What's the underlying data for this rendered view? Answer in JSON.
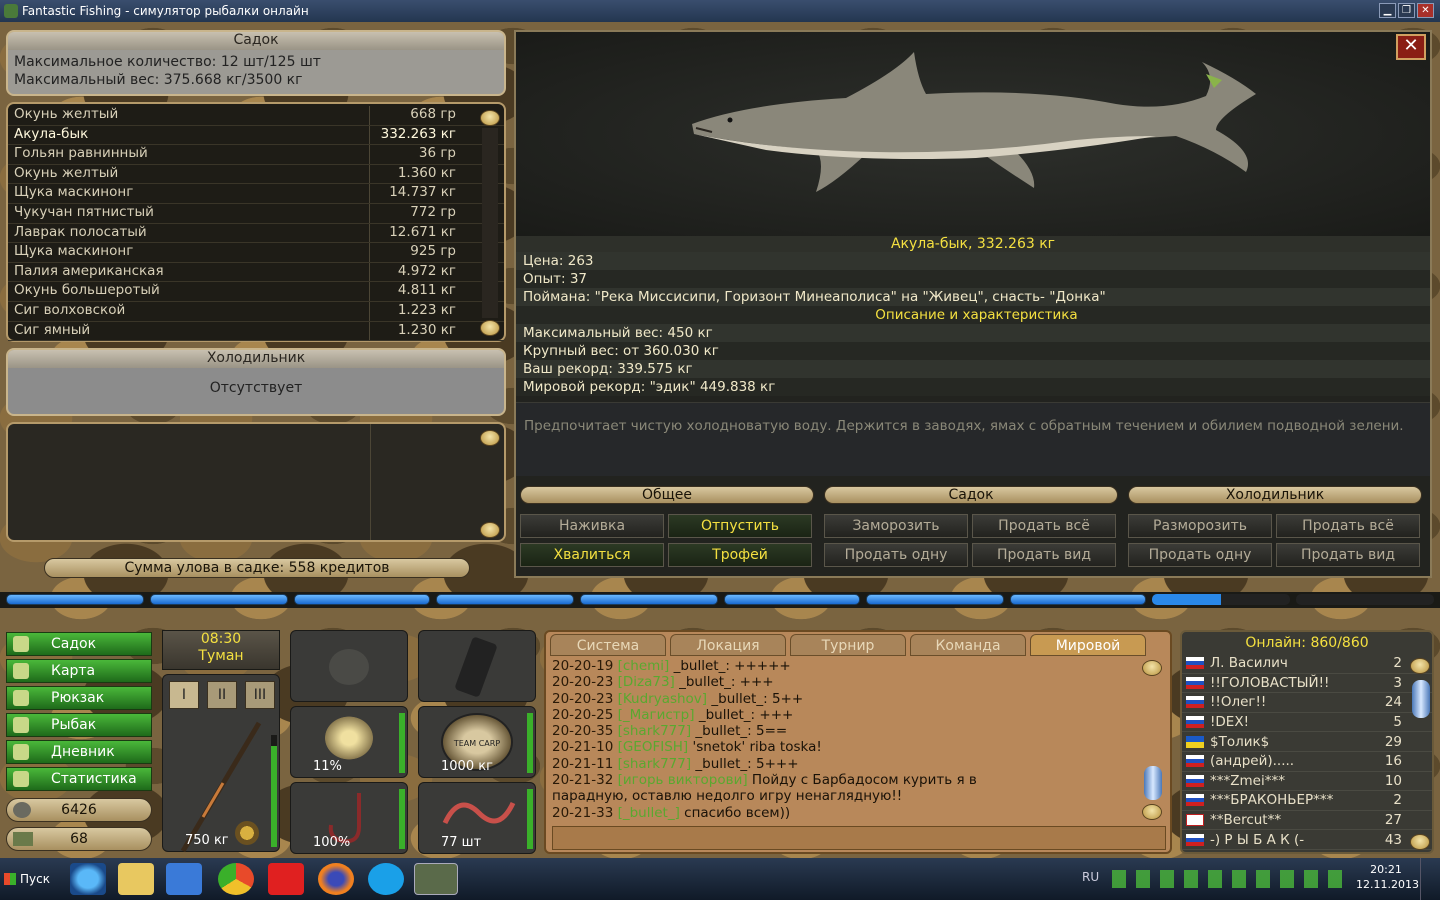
{
  "window": {
    "title": "Fantastic Fishing - симулятор рыбалки онлайн",
    "min": "▁",
    "max": "❐",
    "close": "✕"
  },
  "sadok": {
    "title": "Садок",
    "max_count": "Максимальное количество: 12 шт/125 шт",
    "max_weight": "Максимальный вес: 375.668 кг/3500 кг"
  },
  "fish_list": [
    {
      "name": "Окунь желтый",
      "weight": "668 гр"
    },
    {
      "name": "Акула-бык",
      "weight": "332.263 кг"
    },
    {
      "name": "Гольян равнинный",
      "weight": "36 гр"
    },
    {
      "name": "Окунь желтый",
      "weight": "1.360 кг"
    },
    {
      "name": "Щука маскинонг",
      "weight": "14.737 кг"
    },
    {
      "name": "Чукучан пятнистый",
      "weight": "772 гр"
    },
    {
      "name": "Лаврак полосатый",
      "weight": "12.671 кг"
    },
    {
      "name": "Щука маскинонг",
      "weight": "925 гр"
    },
    {
      "name": "Палия американская",
      "weight": "4.972 кг"
    },
    {
      "name": "Окунь большеротый",
      "weight": "4.811 кг"
    },
    {
      "name": "Сиг волховской",
      "weight": "1.223 кг"
    },
    {
      "name": "Сиг ямный",
      "weight": "1.230 кг"
    }
  ],
  "fridge": {
    "title": "Холодильник",
    "status": "Отсутствует"
  },
  "catch_sum": "Сумма улова в садке: 558 кредитов",
  "fish_info": {
    "title": "Акула-бык, 332.263 кг",
    "price": "Цена: 263",
    "exp": "Опыт: 37",
    "caught": "Поймана: \"Река Миссисипи, Горизонт Минеаполиса\" на \"Живец\", снасть- \"Донка\"",
    "desc_header": "Описание и характеристика",
    "max_weight": "Максимальный вес: 450 кг",
    "big_weight": "Крупный вес: от 360.030 кг",
    "your_record": "Ваш рекорд: 339.575 кг",
    "world_record": "Мировой рекорд: \"эдик\" 449.838 кг",
    "description": "Предпочитает чистую холодноватую воду. Держится в заводях, ямах с обратным течением и обилием подводной зелени."
  },
  "tabs": {
    "general": "Общее",
    "sadok": "Садок",
    "fridge": "Холодильник"
  },
  "actions": {
    "bait": "Наживка",
    "release": "Отпустить",
    "freeze": "Заморозить",
    "sell_all": "Продать всё",
    "defrost": "Разморозить",
    "sell_all2": "Продать всё",
    "brag": "Хвалиться",
    "trophy": "Трофей",
    "sell_one": "Продать одну",
    "sell_kind": "Продать вид",
    "sell_one2": "Продать одну",
    "sell_kind2": "Продать вид"
  },
  "nav": [
    "Садок",
    "Карта",
    "Рюкзак",
    "Рыбак",
    "Дневник",
    "Статистика"
  ],
  "money": {
    "credits": "6426",
    "gold": "68"
  },
  "weather": {
    "time": "08:30",
    "cond": "Туман"
  },
  "gear": {
    "rod": "750 кг",
    "roman": [
      "I",
      "II",
      "III"
    ],
    "reel": "11%",
    "line": "1000 кг",
    "hook": "100%",
    "bait": "77 шт",
    "line_brand": "TEAM CARP"
  },
  "chat": {
    "tabs": [
      "Система",
      "Локация",
      "Турнир",
      "Команда",
      "Мировой"
    ],
    "lines": [
      {
        "t": "20-20-19",
        "u": "[chemi]",
        "m": "_bullet_: +++++"
      },
      {
        "t": "20-20-23",
        "u": "[Diza73]",
        "m": "_bullet_: +++"
      },
      {
        "t": "20-20-23",
        "u": "[Kudryashov]",
        "m": "_bullet_: 5++"
      },
      {
        "t": "20-20-25",
        "u": "[_Магистр]",
        "m": "_bullet_: +++"
      },
      {
        "t": "20-20-35",
        "u": "[shark777]",
        "m": "_bullet_: 5=="
      },
      {
        "t": "20-21-10",
        "u": "[GEOFISH]",
        "m": "'snetok' riba toska!"
      },
      {
        "t": "20-21-11",
        "u": "[shark777]",
        "m": "_bullet_: 5+++"
      },
      {
        "t": "20-21-32",
        "u": "[игорь викторови]",
        "m": "Пойду с Барбадосом курить я в"
      },
      {
        "t": "",
        "u": "",
        "m": "парадную, оставлю недолго игру ненаглядную!!"
      },
      {
        "t": "20-21-33",
        "u": "[_bullet_]",
        "m": "спасибо всем))"
      }
    ]
  },
  "online": {
    "title": "Онлайн: 860/860",
    "users": [
      {
        "name": "Л. Василич",
        "count": "2",
        "flag": "ru"
      },
      {
        "name": "!!ГОЛОВАСТЫЙ!!",
        "count": "3",
        "flag": "ru"
      },
      {
        "name": "!!Олег!!",
        "count": "24",
        "flag": "ru"
      },
      {
        "name": "!DEX!",
        "count": "5",
        "flag": "ru"
      },
      {
        "name": "$Толик$",
        "count": "29",
        "flag": "ua"
      },
      {
        "name": "(андрей).....",
        "count": "16",
        "flag": "ru"
      },
      {
        "name": "***Zmei***",
        "count": "10",
        "flag": "ru"
      },
      {
        "name": "***БРАКОНЬЕР***",
        "count": "2",
        "flag": "ru"
      },
      {
        "name": "**Bercut**",
        "count": "27",
        "flag": "gb"
      },
      {
        "name": "-) Р Ы Б А К (-",
        "count": "43",
        "flag": "ru"
      }
    ]
  },
  "taskbar": {
    "start": "Пуск",
    "lang": "RU",
    "time": "20:21",
    "date": "12.11.2013"
  },
  "colors": {
    "highlight": "#f4e040",
    "green_btn": "#2e8a24",
    "progress": "#2a88e8"
  }
}
